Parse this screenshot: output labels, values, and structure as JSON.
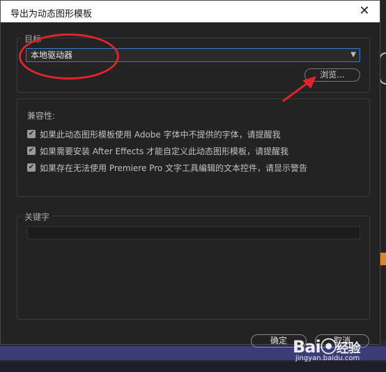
{
  "window": {
    "title": "导出为动态图形模板",
    "close_glyph": "✕"
  },
  "target": {
    "legend": "目标",
    "select_value": "本地驱动器",
    "browse_label": "浏览..."
  },
  "compat": {
    "legend": "兼容性:",
    "options": [
      {
        "label": "如果此动态图形模板使用 Adobe 字体中不提供的字体，请提醒我",
        "checked": true
      },
      {
        "label": "如果需要安装 After Effects 才能自定义此动态图形模板，请提醒我",
        "checked": true
      },
      {
        "label": "如果存在无法使用 Premiere Pro 文字工具编辑的文本控件，请显示警告",
        "checked": true
      }
    ]
  },
  "keywords": {
    "legend": "关键字",
    "value": ""
  },
  "footer": {
    "ok_label": "确定",
    "cancel_label": "取消"
  },
  "watermark": {
    "logo_text": "Bai",
    "logo_text2": "百",
    "logo_text3": "经验",
    "url": "jingyan.baidu.com"
  },
  "annotation_color": "#e0242a",
  "accent_color": "#3a7bd5"
}
